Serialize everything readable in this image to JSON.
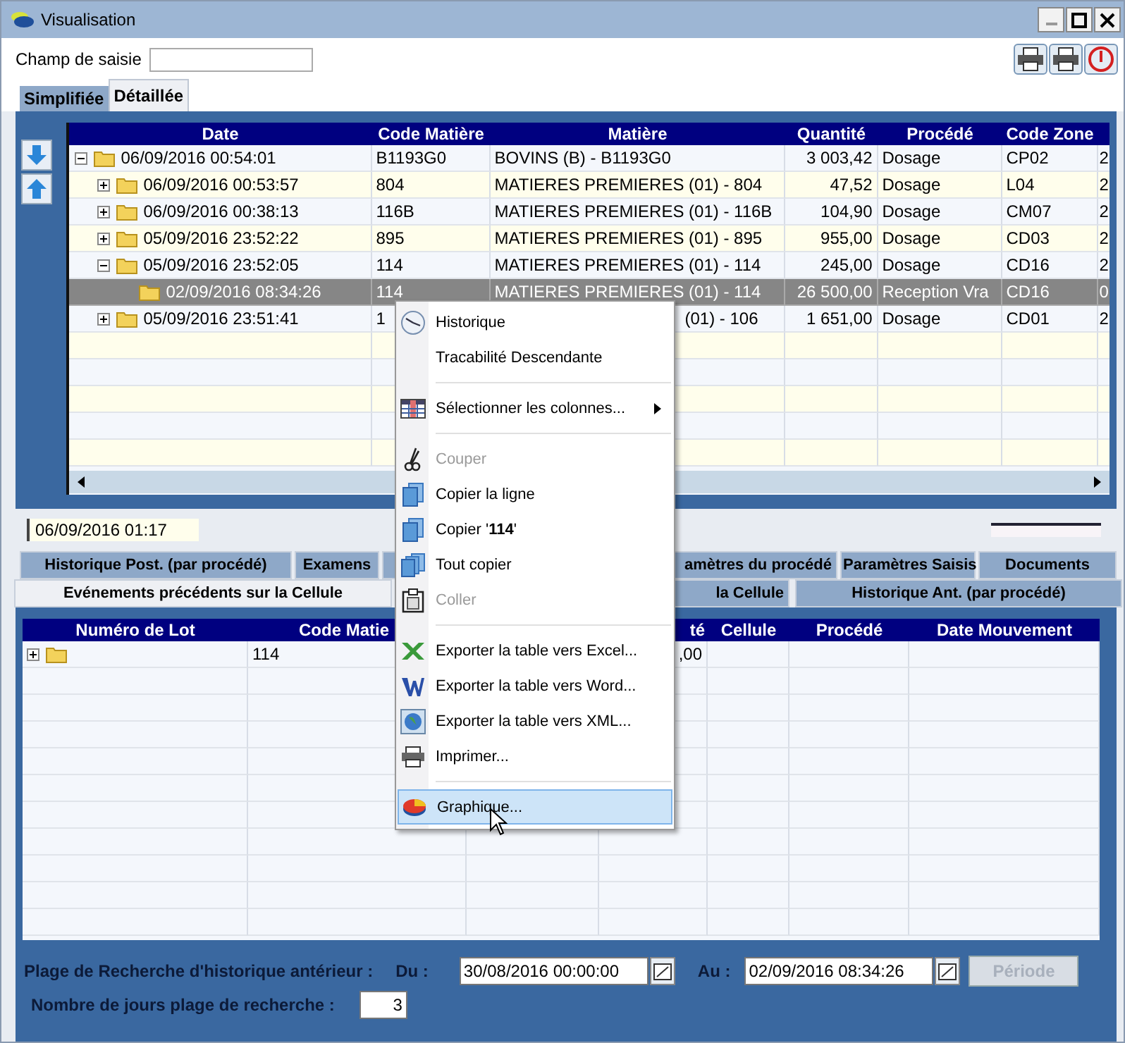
{
  "window": {
    "title": "Visualisation"
  },
  "search": {
    "label": "Champ de saisie"
  },
  "view_tabs": [
    {
      "label": "Simplifiée",
      "selected": false
    },
    {
      "label": "Détaillée",
      "selected": true
    }
  ],
  "main_table": {
    "columns": [
      {
        "label": "Date"
      },
      {
        "label": "Code Matière"
      },
      {
        "label": "Matière"
      },
      {
        "label": "Quantité"
      },
      {
        "label": "Procédé"
      },
      {
        "label": "Code Zone"
      }
    ],
    "rows": [
      {
        "date": "06/09/2016 00:54:01",
        "code": "B1193G0",
        "matiere": "BOVINS (B) - B1193G0",
        "quantite": "3 003,42",
        "procede": "Dosage",
        "zone": "CP02",
        "col7": "2",
        "selected": false,
        "expanded": true,
        "children": [
          {
            "date": "06/09/2016 00:53:57",
            "code": "804",
            "matiere": "MATIERES PREMIERES (01) - 804",
            "quantite": "47,52",
            "procede": "Dosage",
            "zone": "L04",
            "col7": "2",
            "selected": false,
            "expanded": false
          },
          {
            "date": "06/09/2016 00:38:13",
            "code": "116B",
            "matiere": "MATIERES PREMIERES (01) - 116B",
            "quantite": "104,90",
            "procede": "Dosage",
            "zone": "CM07",
            "col7": "2",
            "selected": false,
            "expanded": false
          },
          {
            "date": "05/09/2016 23:52:22",
            "code": "895",
            "matiere": "MATIERES PREMIERES (01) - 895",
            "quantite": "955,00",
            "procede": "Dosage",
            "zone": "CD03",
            "col7": "2",
            "selected": false,
            "expanded": false
          },
          {
            "date": "05/09/2016 23:52:05",
            "code": "114",
            "matiere": "MATIERES PREMIERES (01) - 114",
            "quantite": "245,00",
            "procede": "Dosage",
            "zone": "CD16",
            "col7": "2",
            "selected": false,
            "expanded": true,
            "children": [
              {
                "date": "02/09/2016 08:34:26",
                "code": "114",
                "matiere": "MATIERES PREMIERES (01) - 114",
                "quantite": "26 500,00",
                "procede": "Reception Vra",
                "zone": "CD16",
                "col7": "0",
                "selected": true
              }
            ]
          },
          {
            "date": "05/09/2016 23:51:41",
            "code": "1",
            "matiere": "(01) - 106",
            "quantite": "1 651,00",
            "procede": "Dosage",
            "zone": "CD01",
            "col7": "2",
            "selected": false,
            "expanded": false,
            "covered": true
          }
        ]
      }
    ]
  },
  "status_field": {
    "value": "06/09/2016 01:17"
  },
  "detail_tabs_top": [
    {
      "label": "Historique Post. (par procédé)",
      "selected": false
    },
    {
      "label": "Examens",
      "selected": false
    },
    {
      "label": "amètres du procédé",
      "selected": false,
      "covered": true
    },
    {
      "label": "Paramètres Saisis",
      "selected": false
    },
    {
      "label": "Documents",
      "selected": false
    }
  ],
  "detail_tabs_bottom": [
    {
      "label": "Evénements précédents sur la Cellule",
      "selected": true
    },
    {
      "label": "la Cellule",
      "selected": false,
      "covered": true
    },
    {
      "label": "Historique Ant. (par procédé)",
      "selected": false
    }
  ],
  "lower_table": {
    "columns": [
      {
        "label": "Numéro de Lot"
      },
      {
        "label": "Code Matie"
      },
      {
        "label": "té",
        "covered": true
      },
      {
        "label": "Cellule"
      },
      {
        "label": "Procédé"
      },
      {
        "label": "Date Mouvement"
      }
    ],
    "rows": [
      {
        "code": "114",
        "quantite": ",00",
        "expanded": false
      }
    ]
  },
  "range": {
    "label": "Plage de Recherche d'historique antérieur :",
    "from_label": "Du :",
    "from": "30/08/2016 00:00:00",
    "to_label": "Au :",
    "to": "02/09/2016 08:34:26",
    "button": "Période",
    "button_disabled": true
  },
  "days": {
    "label": "Nombre de jours plage de recherche :",
    "value": "3"
  },
  "context_menu": [
    {
      "kind": "item",
      "label": "Historique",
      "disabled": false,
      "selected": false
    },
    {
      "kind": "item",
      "label": "Tracabilité Descendante",
      "disabled": false,
      "selected": false
    },
    {
      "kind": "separator"
    },
    {
      "kind": "submenu",
      "label": "Sélectionner les colonnes...",
      "disabled": false,
      "selected": false
    },
    {
      "kind": "separator"
    },
    {
      "kind": "item",
      "label": "Couper",
      "disabled": true,
      "selected": false
    },
    {
      "kind": "item",
      "label": "Copier la ligne",
      "disabled": false,
      "selected": false
    },
    {
      "kind": "item",
      "label": "Copier '**114**'",
      "disabled": false,
      "selected": false
    },
    {
      "kind": "item",
      "label": "Tout copier",
      "disabled": false,
      "selected": false
    },
    {
      "kind": "item",
      "label": "Coller",
      "disabled": true,
      "selected": false
    },
    {
      "kind": "separator"
    },
    {
      "kind": "item",
      "label": "Exporter la table vers Excel...",
      "disabled": false,
      "selected": false
    },
    {
      "kind": "item",
      "label": "Exporter la table vers Word...",
      "disabled": false,
      "selected": false
    },
    {
      "kind": "item",
      "label": "Exporter la table vers XML...",
      "disabled": false,
      "selected": false
    },
    {
      "kind": "item",
      "label": "Imprimer...",
      "disabled": false,
      "selected": false
    },
    {
      "kind": "separator"
    },
    {
      "kind": "item",
      "label": "Graphique...",
      "disabled": false,
      "selected": true
    }
  ]
}
